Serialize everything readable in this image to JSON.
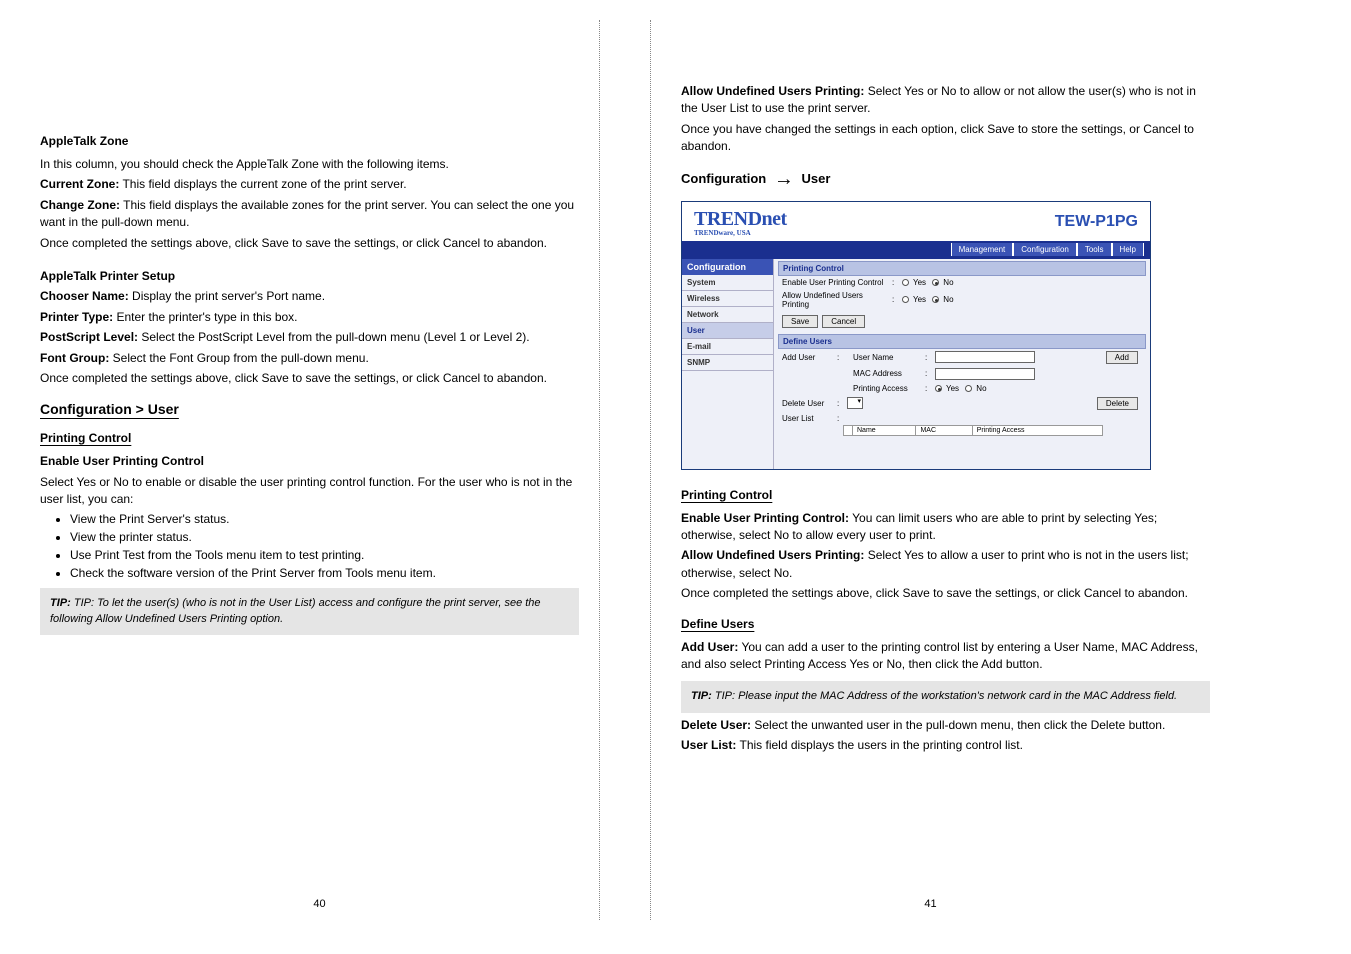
{
  "left_page": {
    "apple_zone": {
      "heading": "AppleTalk Zone",
      "intro": "In this column, you should check the AppleTalk Zone with the following items.",
      "current_zone": {
        "label": "Current Zone:",
        "text": "This field displays the current zone of the print server."
      },
      "change_zone": {
        "label": "Change Zone:",
        "text": "This field displays the available zones for the print server. You can select the one you want in the pull-down menu."
      },
      "save_cancel": "Once completed the settings above, click Save to save the settings, or click Cancel to abandon."
    },
    "printer_setup": {
      "heading": "AppleTalk Printer Setup",
      "chooser": {
        "label": "Chooser Name:",
        "text": "Display the print server's Port name."
      },
      "type": {
        "label": "Printer Type:",
        "text": "Enter the printer's type in this box."
      },
      "postscript": {
        "label": "PostScript Level:",
        "text": "Select the PostScript Level from the pull-down menu (Level 1 or Level 2)."
      },
      "font_group": {
        "label": "Font Group:",
        "text": "Select the Font Group from the pull-down menu."
      },
      "save_cancel": "Once completed the settings above, click Save to save the settings, or click Cancel to abandon."
    },
    "section": "Configuration > User",
    "printing_control": {
      "heading": "Printing Control",
      "enable_label": "Enable User Printing Control",
      "enable_text": "Select Yes or No to enable or disable the user printing control function. For the user who is not in the user list, you can:",
      "options": [
        "View the Print Server's status.",
        "View the printer status.",
        "Use Print Test from the Tools menu item to test printing.",
        "Check the software version of the Print Server from Tools menu item."
      ]
    },
    "tip": "TIP: To let the user(s) (who is not in the User List) access and configure the print server, see the following Allow Undefined Users Printing option.",
    "page_number": "40"
  },
  "right_page": {
    "allow_undefined": {
      "label": "Allow Undefined Users Printing:",
      "text": "Select Yes or No to allow or not allow the user(s) who is not in the User List to use the print server."
    },
    "save_cancel": "Once you have changed the settings in each option, click Save to store the settings, or Cancel to abandon.",
    "arrow_path": {
      "a": "Configuration",
      "b": "User"
    },
    "screenshot": {
      "brand": "TRENDnet",
      "brand_sub": "TRENDware, USA",
      "model": "TEW-P1PG",
      "nav": [
        "Management",
        "Configuration",
        "Tools",
        "Help"
      ],
      "sidebar": {
        "head": "Configuration",
        "items": [
          "System",
          "Wireless",
          "Network",
          "User",
          "E-mail",
          "SNMP"
        ],
        "active": "User"
      },
      "block1": {
        "head": "Printing Control",
        "row1": "Enable User Printing Control",
        "row2": "Allow Undefined Users Printing",
        "yes": "Yes",
        "no": "No",
        "save": "Save",
        "cancel": "Cancel"
      },
      "block2": {
        "head": "Define Users",
        "add_user": "Add User",
        "user_name": "User Name",
        "mac": "MAC Address",
        "printing_access": "Printing Access",
        "yes": "Yes",
        "no": "No",
        "add": "Add",
        "delete_user": "Delete User",
        "delete": "Delete",
        "user_list": "User List",
        "table": {
          "name": "Name",
          "mac": "MAC",
          "pa": "Printing Access"
        }
      }
    },
    "printing_control": {
      "heading": "Printing Control",
      "enable": {
        "label": "Enable User Printing Control:",
        "text": "You can limit users who are able to print by selecting Yes; otherwise, select No to allow every user to print."
      },
      "allow": {
        "label": "Allow Undefined Users Printing:",
        "text": "Select Yes to allow a user to print who is not in the users list; otherwise, select No."
      },
      "save_cancel": "Once completed the settings above, click Save to save the settings, or click Cancel to abandon."
    },
    "define_users": {
      "heading": "Define Users",
      "add": {
        "label": "Add User:",
        "text": "You can add a user to the printing control list by entering a User Name, MAC Address, and also select Printing Access Yes or No, then click the Add button."
      },
      "tip": "TIP: Please input the MAC Address of the workstation's network card in the MAC Address field.",
      "delete": {
        "label": "Delete User:",
        "text": "Select the unwanted user in the pull-down menu, then click the Delete button."
      },
      "list": {
        "label": "User List:",
        "text": "This field displays the users in the printing control list."
      }
    },
    "page_number": "41"
  }
}
